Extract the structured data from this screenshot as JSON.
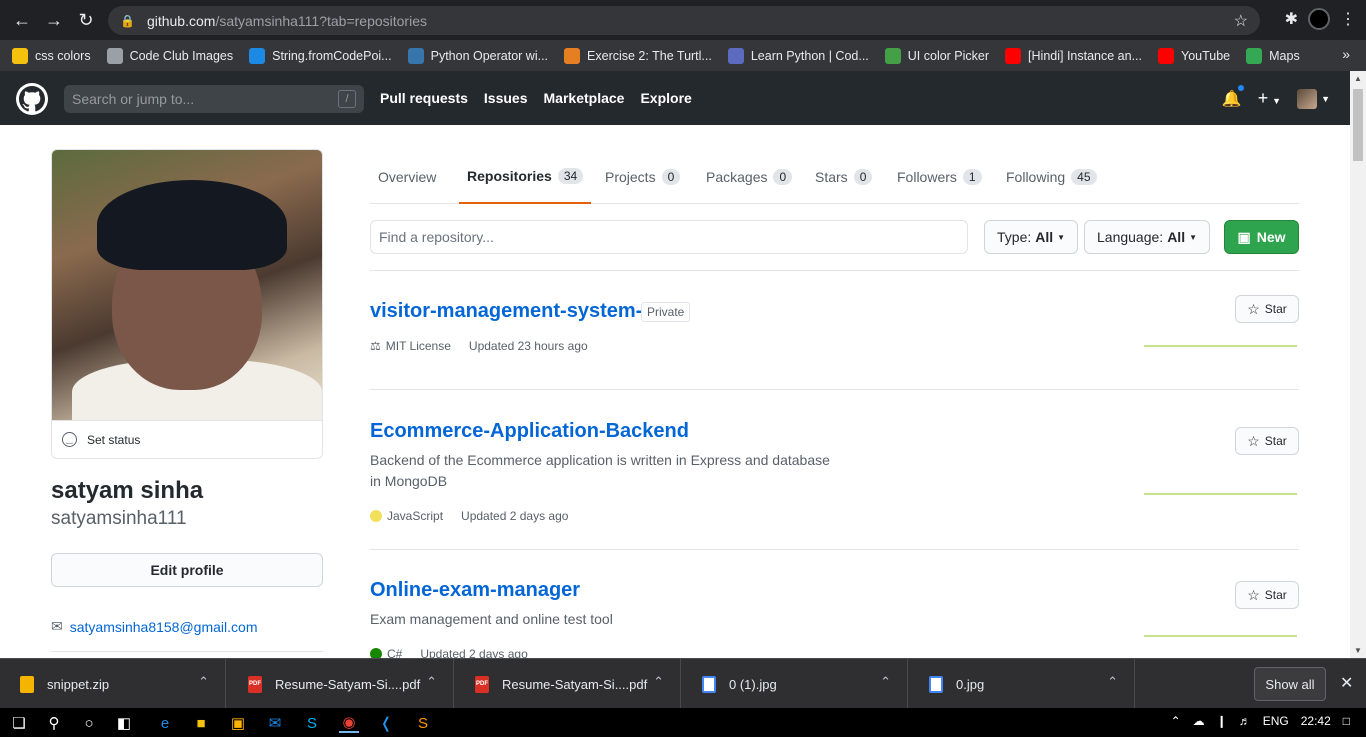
{
  "browser": {
    "url_host": "github.com",
    "url_path": "/satyamsinha111?tab=repositories",
    "bookmarks": [
      {
        "label": "css colors",
        "icon": "css-colors-icon",
        "color": "#f4c20d"
      },
      {
        "label": "Code Club Images",
        "icon": "globe-icon",
        "color": "#9aa0a6"
      },
      {
        "label": "String.fromCodePoi...",
        "icon": "doc-icon",
        "color": "#1e88e5"
      },
      {
        "label": "Python Operator wi...",
        "icon": "python-icon",
        "color": "#3776ab"
      },
      {
        "label": "Exercise 2: The Turtl...",
        "icon": "turtle-icon",
        "color": "#e67e22"
      },
      {
        "label": "Learn Python | Cod...",
        "icon": "code-icon",
        "color": "#5c6bc0"
      },
      {
        "label": "UI color Picker",
        "icon": "picker-icon",
        "color": "#43a047"
      },
      {
        "label": "[Hindi] Instance an...",
        "icon": "youtube-icon",
        "color": "#ff0000"
      },
      {
        "label": "YouTube",
        "icon": "youtube-icon",
        "color": "#ff0000"
      },
      {
        "label": "Maps",
        "icon": "maps-icon",
        "color": "#34a853"
      }
    ]
  },
  "header": {
    "search_placeholder": "Search or jump to...",
    "search_key": "/",
    "nav": [
      "Pull requests",
      "Issues",
      "Marketplace",
      "Explore"
    ]
  },
  "profile": {
    "set_status": "Set status",
    "fullname": "satyam sinha",
    "username": "satyamsinha111",
    "edit_profile": "Edit profile",
    "email": "satyamsinha8158@gmail.com"
  },
  "tabs": [
    {
      "label": "Overview",
      "count": null
    },
    {
      "label": "Repositories",
      "count": "34"
    },
    {
      "label": "Projects",
      "count": "0"
    },
    {
      "label": "Packages",
      "count": "0"
    },
    {
      "label": "Stars",
      "count": "0"
    },
    {
      "label": "Followers",
      "count": "1"
    },
    {
      "label": "Following",
      "count": "45"
    }
  ],
  "filters": {
    "find_placeholder": "Find a repository...",
    "type_label": "Type:",
    "type_value": "All",
    "language_label": "Language:",
    "language_value": "All",
    "new_label": "New"
  },
  "repos": [
    {
      "name": "visitor-management-system-",
      "badge": "Private",
      "description": "",
      "license": "MIT License",
      "language": "",
      "language_color": "",
      "updated": "Updated 23 hours ago",
      "star_label": "Star"
    },
    {
      "name": "Ecommerce-Application-Backend",
      "badge": "",
      "description": "Backend of the Ecommerce application is written in Express and database in MongoDB",
      "license": "",
      "language": "JavaScript",
      "language_color": "#f1e05a",
      "updated": "Updated 2 days ago",
      "star_label": "Star"
    },
    {
      "name": "Online-exam-manager",
      "badge": "",
      "description": "Exam management and online test tool",
      "license": "",
      "language": "C#",
      "language_color": "#178600",
      "updated": "Updated 2 days ago",
      "star_label": "Star"
    }
  ],
  "downloads": {
    "items": [
      {
        "name": "snippet.zip",
        "type": "zip",
        "color": "#f4b400"
      },
      {
        "name": "Resume-Satyam-Si....pdf",
        "type": "PDF",
        "color": "#d93025"
      },
      {
        "name": "Resume-Satyam-Si....pdf",
        "type": "PDF",
        "color": "#d93025"
      },
      {
        "name": "0 (1).jpg",
        "type": "jpg",
        "color": "#ffffff"
      },
      {
        "name": "0.jpg",
        "type": "jpg",
        "color": "#ffffff"
      }
    ],
    "show_all": "Show all"
  },
  "taskbar": {
    "language": "ENG",
    "time": "22:42"
  }
}
